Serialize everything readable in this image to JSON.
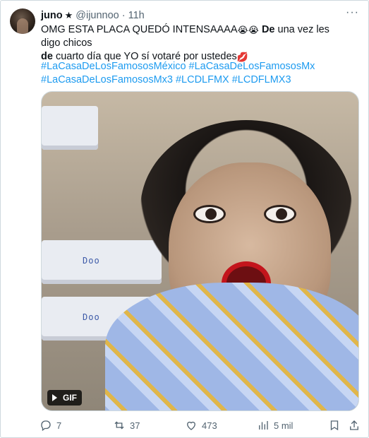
{
  "author": {
    "name": "juno",
    "star": "★",
    "handle": "@ijunnoo",
    "separator": "·",
    "time": "11h"
  },
  "tweet": {
    "text_part1": "OMG ESTA PLACA QUEDÓ INTENSAAAA",
    "emoji1": "😭😭",
    "bold1": "De",
    "text_part2": " una vez les digo chicos",
    "bold2": "de",
    "text_part3": " cuarto día que YO sí votaré por ustedes",
    "emoji2": "💋",
    "hashtags": [
      "#LaCasaDeLosFamososMéxico",
      "#LaCasaDeLosFamososMx",
      "#LaCasaDeLosFamososMx3",
      "#LCDLFMX",
      "#LCDFLMX3"
    ]
  },
  "media": {
    "badge": "GIF",
    "box_label": "Doo"
  },
  "actions": {
    "replies": "7",
    "retweets": "37",
    "likes": "473",
    "views": "5 mil"
  },
  "colors": {
    "link": "#1d9bf0",
    "muted": "#536471",
    "text": "#0f1419",
    "border": "#cfd9de"
  }
}
